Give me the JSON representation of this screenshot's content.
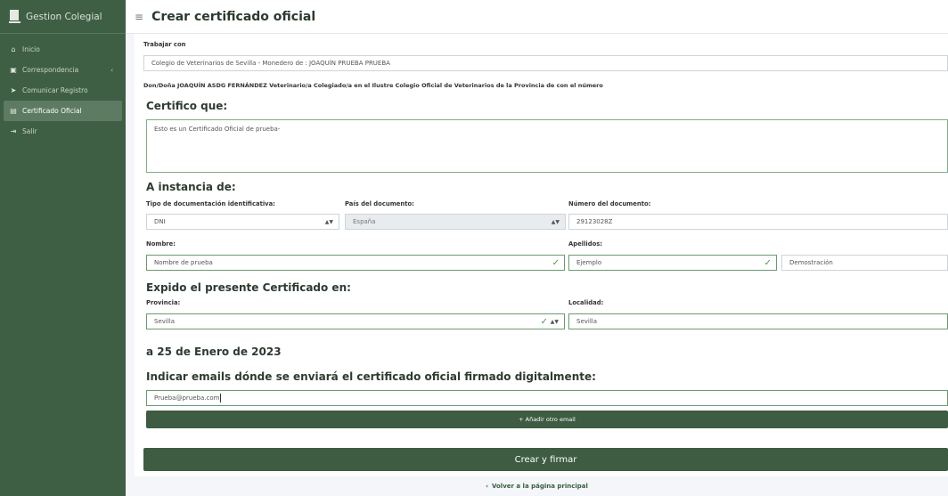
{
  "app": {
    "name": "Gestion Colegial"
  },
  "sidebar": {
    "items": [
      {
        "label": "Inicio",
        "icon": "home-icon"
      },
      {
        "label": "Correspondencia",
        "icon": "inbox-icon"
      },
      {
        "label": "Comunicar Registro",
        "icon": "send-icon"
      },
      {
        "label": "Certificado Oficial",
        "icon": "document-icon"
      },
      {
        "label": "Salir",
        "icon": "sign-out-icon"
      }
    ]
  },
  "header": {
    "title": "Crear certificado oficial"
  },
  "form": {
    "trabajar_label": "Trabajar con",
    "trabajar_value": "Colegio de Veterinarios de Sevilla - Monedero de : JOAQUÍN PRUEBA PRUEBA",
    "declaracion_prefix": "Don/Doña",
    "declaracion_name": "JOAQUÍN ASDG FERNÁNDEZ",
    "declaracion_rest": "Veterinario/a Colegiado/a en el Ilustre Colegio Oficial de Veterinarios de la Provincia de con el número",
    "certifico_heading": "Certifico que:",
    "certifico_text": "Esto es un Certificado Oficial de prueba-",
    "instancia_heading": "A instancia de:",
    "tipo_doc_label": "Tipo de documentación identificativa:",
    "tipo_doc_value": "DNI",
    "pais_label": "País del documento:",
    "pais_value": "España",
    "numero_label": "Número del documento:",
    "numero_value": "29123028Z",
    "nombre_label": "Nombre:",
    "nombre_value": "Nombre de prueba",
    "apellidos_label": "Apellidos:",
    "apellido1_value": "Ejemplo",
    "apellido2_value": "Demostración",
    "expido_heading": "Expido el presente Certificado en:",
    "provincia_label": "Provincia:",
    "provincia_value": "Sevilla",
    "localidad_label": "Localidad:",
    "localidad_value": "Sevilla",
    "fecha": "a 25 de Enero de 2023",
    "emails_heading": "Indicar emails dónde se enviará el certificado oficial firmado digitalmente:",
    "email_value": "Prueba@prueba.com",
    "add_email_label": "+ Añadir otro email",
    "submit_label": "Crear y firmar"
  },
  "footer": {
    "back_label": "Volver a la página principal"
  }
}
